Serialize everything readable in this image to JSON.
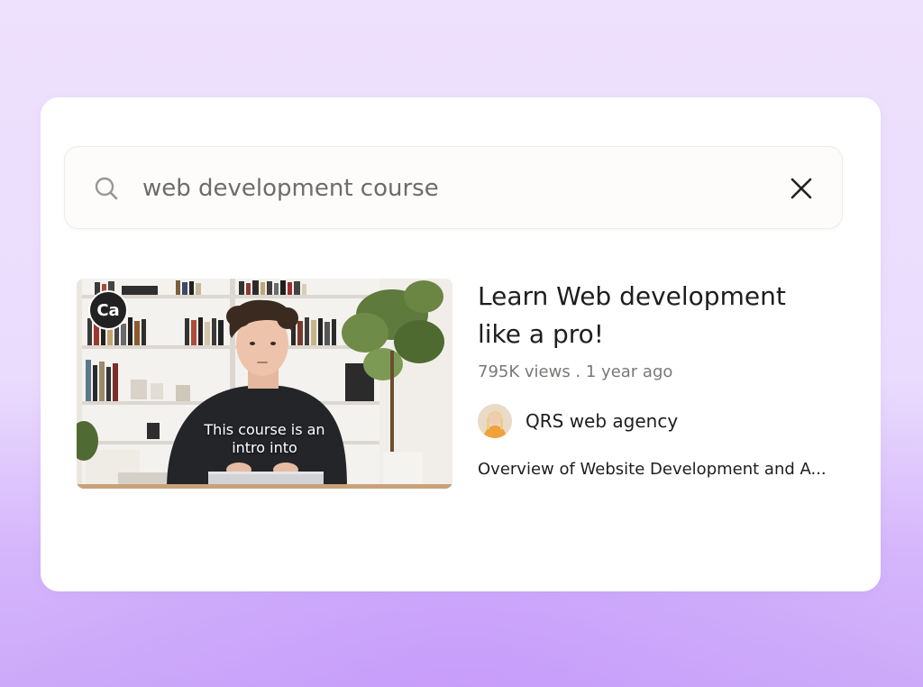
{
  "search": {
    "query": "web development course"
  },
  "result": {
    "badge": "Ca",
    "caption_line1": "This course is an",
    "caption_line2": "intro into",
    "title_line1": "Learn Web development",
    "title_line2": "like a pro!",
    "meta": "795K views . 1 year ago",
    "channel": "QRS web agency",
    "description": "Overview of Website Development and A..."
  },
  "colors": {
    "background": "#eadcfd",
    "card": "#ffffff",
    "text": "#1e1e1e",
    "muted": "#7a7877"
  }
}
